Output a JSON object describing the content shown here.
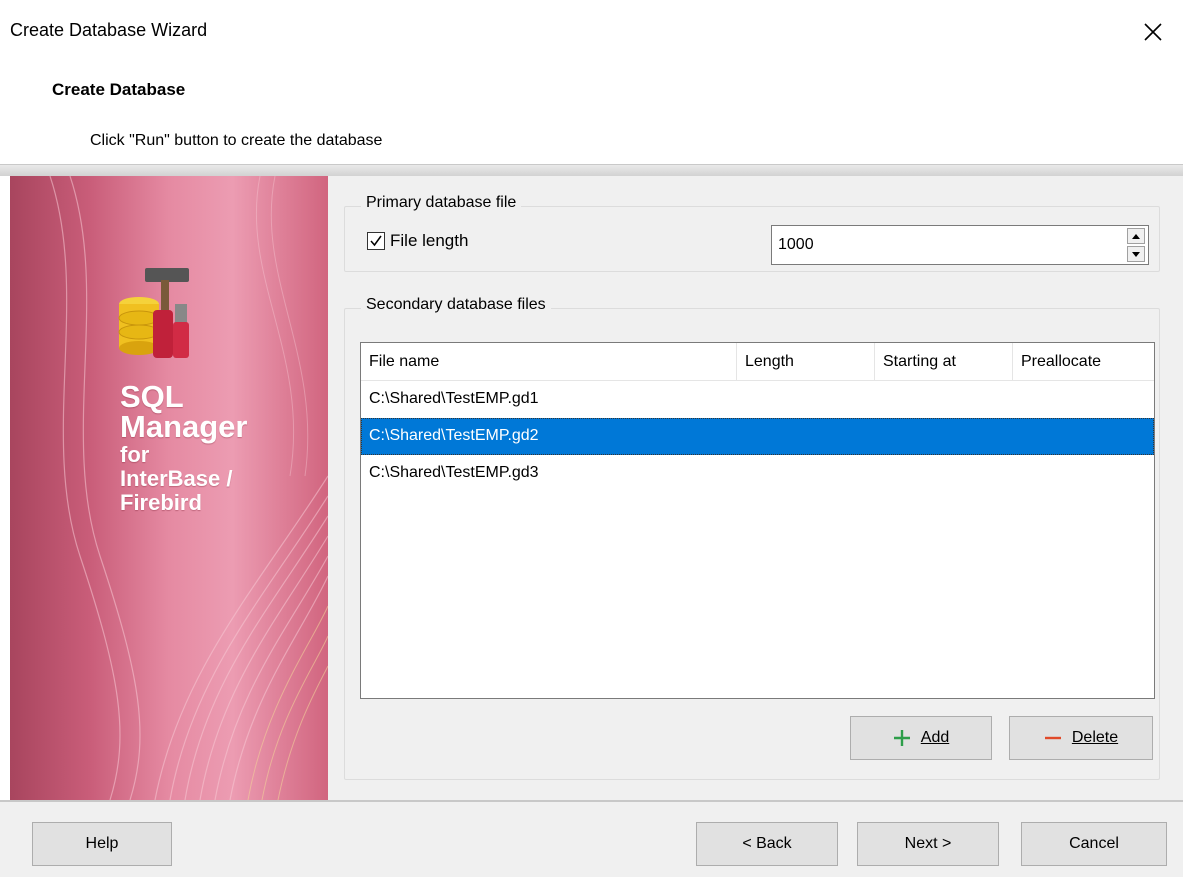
{
  "window": {
    "title": "Create Database Wizard"
  },
  "header": {
    "title": "Create Database",
    "subtitle": "Click \"Run\" button to create the database"
  },
  "sidebar": {
    "brand_line1": "SQL",
    "brand_line2": "Manager",
    "brand_line3": "for",
    "brand_line4": "InterBase /",
    "brand_line5": "Firebird"
  },
  "primary": {
    "legend": "Primary database file",
    "file_length_label": "File length",
    "file_length_checked": true,
    "file_length_value": "1000"
  },
  "secondary": {
    "legend": "Secondary database files",
    "columns": [
      "File name",
      "Length",
      "Starting at",
      "Preallocate"
    ],
    "rows": [
      {
        "file_name": "C:\\Shared\\TestEMP.gd1",
        "selected": false
      },
      {
        "file_name": "C:\\Shared\\TestEMP.gd2",
        "selected": true
      },
      {
        "file_name": "C:\\Shared\\TestEMP.gd3",
        "selected": false
      }
    ],
    "add_label": "Add",
    "delete_label": "Delete"
  },
  "footer": {
    "help_label": "Help",
    "back_label": "< Back",
    "next_label": "Next >",
    "cancel_label": "Cancel"
  },
  "colors": {
    "selection": "#0078d7",
    "sidebar_accent": "#d1657f",
    "add_icon": "#2e9e4a",
    "delete_icon": "#e04a2a"
  },
  "icons": {
    "close": "close-icon",
    "add": "plus-icon",
    "delete": "minus-icon",
    "logo": "database-tools-icon"
  }
}
